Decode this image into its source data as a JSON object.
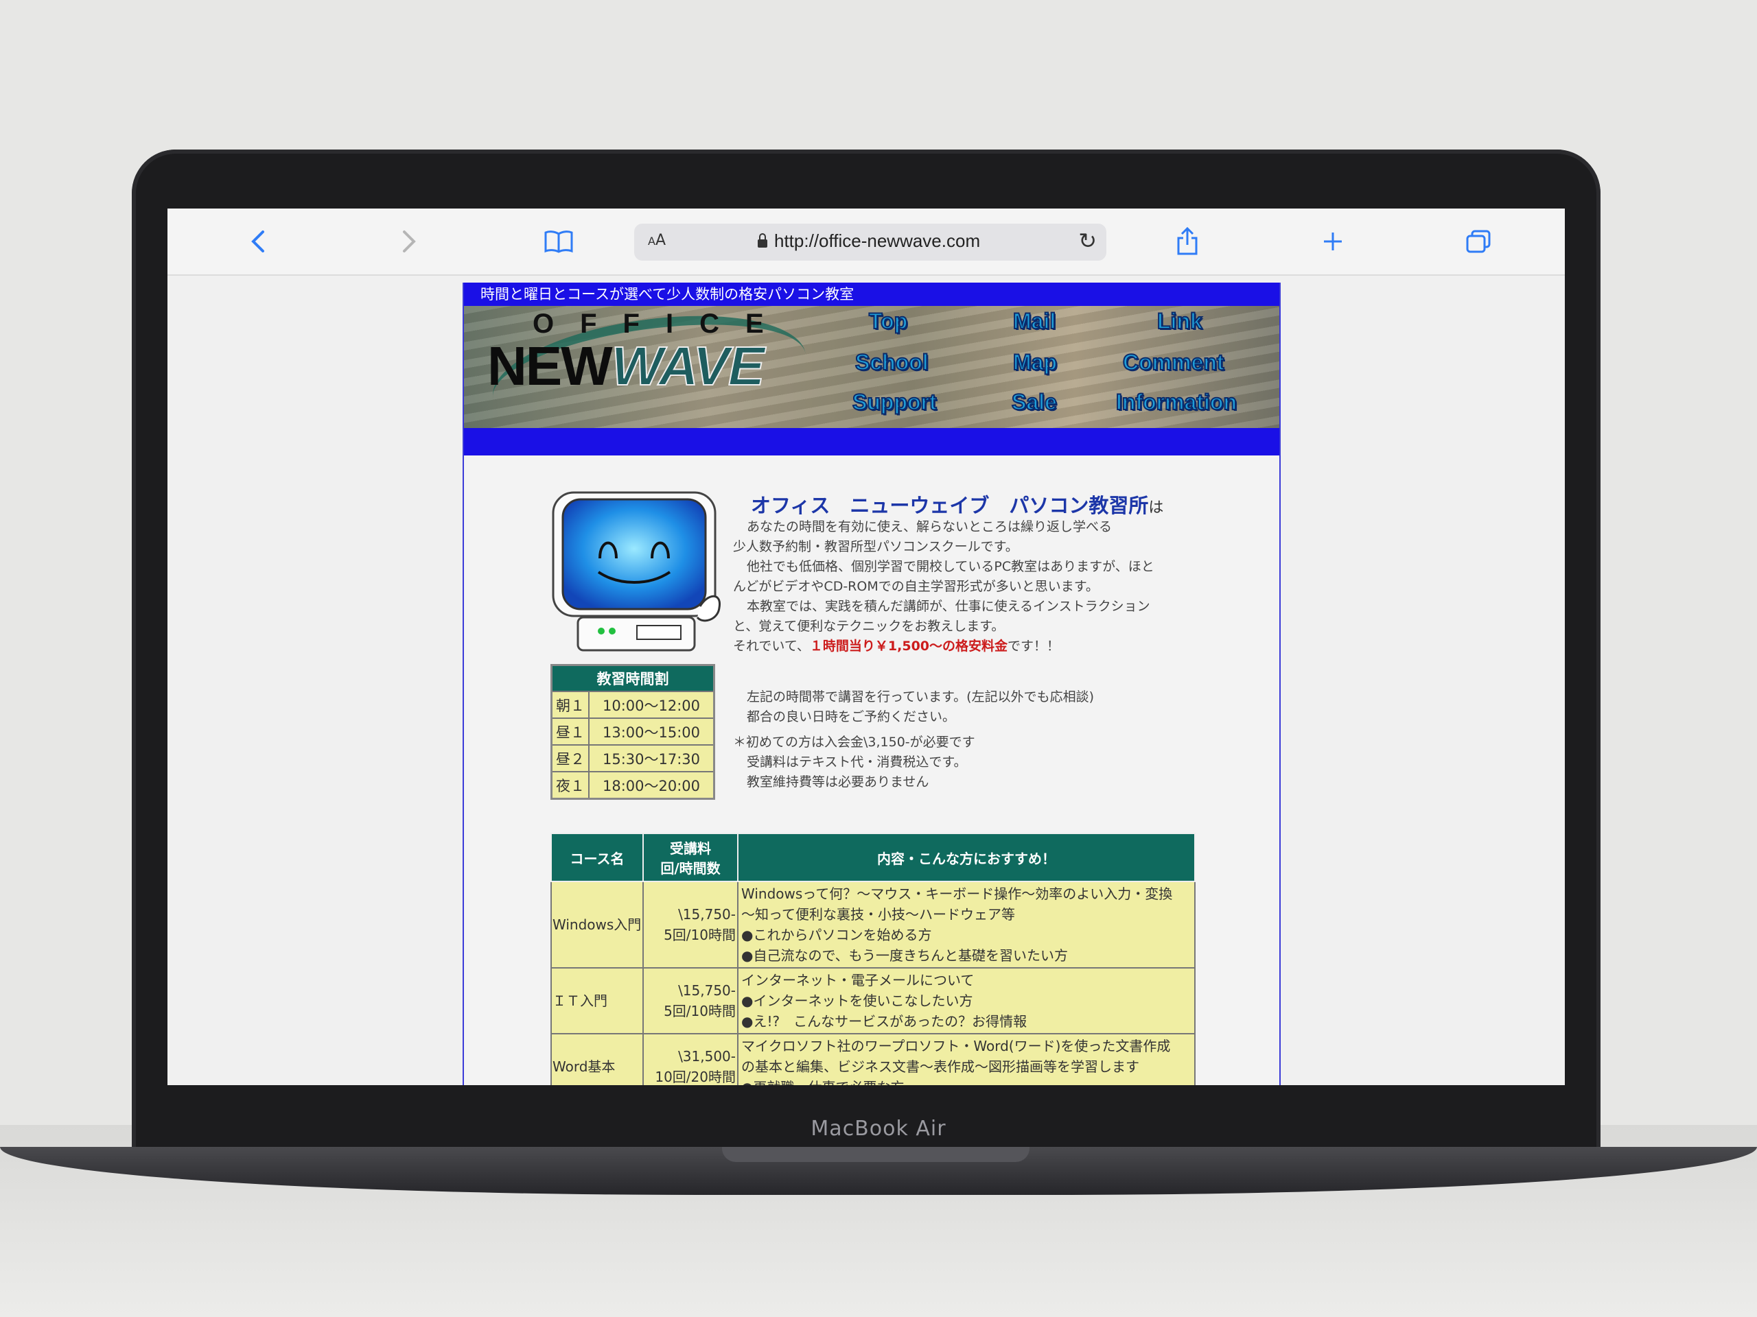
{
  "device": {
    "model": "MacBook Air"
  },
  "browser": {
    "url": "http://office-newwave.com",
    "aa_label": "AA",
    "icons": [
      "chevron-left-icon",
      "chevron-right-icon",
      "bookmarks-icon",
      "lock-icon",
      "reload-icon",
      "share-icon",
      "plus-icon",
      "tabs-icon"
    ]
  },
  "site": {
    "tagline": "時間と曜日とコースが選べて少人数制の格安パソコン教室",
    "logo": {
      "top": "OFFICE",
      "new": "NEW",
      "wave": "WAVE"
    },
    "nav": [
      "Top",
      "Mail",
      "Link",
      "School",
      "Map",
      "Comment",
      "Support",
      "Sale",
      "Information"
    ]
  },
  "intro": {
    "headline": "オフィス　ニューウェイブ　パソコン教習所",
    "headline_suffix": "は",
    "lines": [
      "あなたの時間を有効に使え、解らないところは繰り返し学べる",
      "少人数予約制・教習所型パソコンスクールです。",
      "他社でも低価格、個別学習で開校しているPC教室はありますが、ほと",
      "んどがビデオやCD-ROMでの自主学習形式が多いと思います。",
      "本教室では、実践を積んだ講師が、仕事に使えるインストラクション",
      "と、覚えて便利なテクニックをお教えします。"
    ],
    "price_prefix": "それでいて、",
    "price_highlight": "１時間当り￥1,500～の格安料金",
    "price_suffix": "です！！"
  },
  "schedule_note": {
    "lines": [
      "左記の時間帯で講習を行っています。(左記以外でも応相談)",
      "都合の良い日時をご予約ください。"
    ]
  },
  "fee_note": {
    "lines": [
      "＊初めての方は入会金\\3,150-が必要です",
      "受講料はテキスト代・消費税込です。",
      "教室維持費等は必要ありません"
    ]
  },
  "schedule": {
    "title": "教習時間割",
    "rows": [
      {
        "slot": "朝１",
        "time": "10:00～12:00"
      },
      {
        "slot": "昼１",
        "time": "13:00～15:00"
      },
      {
        "slot": "昼２",
        "time": "15:30～17:30"
      },
      {
        "slot": "夜１",
        "time": "18:00～20:00"
      }
    ]
  },
  "courses": {
    "headers": {
      "name": "コース名",
      "fee_line1": "受講料",
      "fee_line2": "回/時間数",
      "desc": "内容・こんな方におすすめ！"
    },
    "rows": [
      {
        "name": "Windows入門",
        "fee": "\\15,750-",
        "sessions": "5回/10時間",
        "desc": [
          "Windowsって何？～マウス・キーボード操作～効率のよい入力・変換",
          "～知って便利な裏技・小技～ハードウェア等",
          "●これからパソコンを始める方",
          "●自己流なので、もう一度きちんと基礎を習いたい方"
        ]
      },
      {
        "name": "ＩＴ入門",
        "fee": "\\15,750-",
        "sessions": "5回/10時間",
        "desc": [
          "インターネット・電子メールについて",
          "●インターネットを使いこなしたい方",
          "●え!?　こんなサービスがあったの？お得情報"
        ]
      },
      {
        "name": "Word基本",
        "fee": "\\31,500-",
        "sessions": "10回/20時間",
        "desc": [
          "マイクロソフト社のワープロソフト・Word(ワード)を使った文書作成",
          "の基本と編集、ビジネス文書～表作成～図形描画等を学習します",
          "●再就職、仕事で必要な方"
        ]
      }
    ]
  }
}
